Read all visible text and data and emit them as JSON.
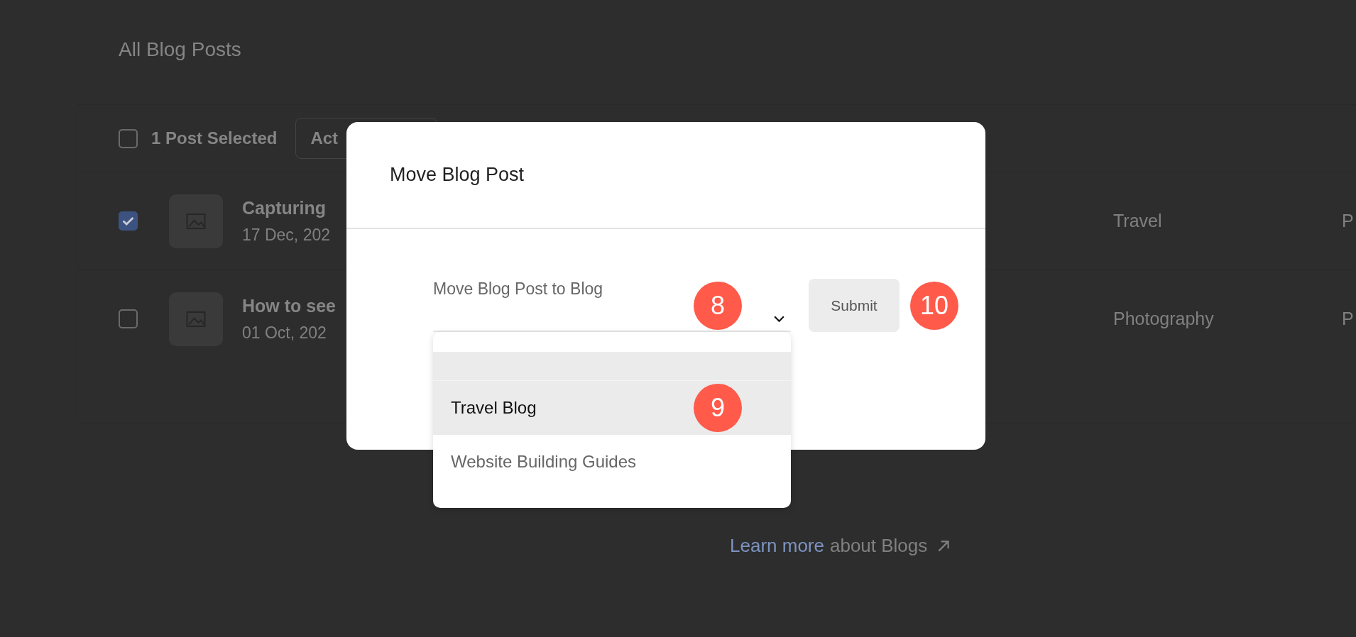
{
  "page": {
    "title": "All Blog Posts",
    "toolbar": {
      "select_all_checked": false,
      "selection_count": "1 Post Selected",
      "actions_button": "Act"
    },
    "posts": [
      {
        "checked": true,
        "title": "Capturing",
        "date": "17 Dec, 202",
        "category": "Travel",
        "status": "P"
      },
      {
        "checked": false,
        "title": "How to see",
        "date": "01 Oct, 202",
        "category": "Photography",
        "status": "P"
      }
    ],
    "help_link": {
      "link": "Learn more",
      "text": "about Blogs"
    }
  },
  "modal": {
    "title": "Move Blog Post",
    "field_label": "Move Blog Post to Blog",
    "dropdown": {
      "blank_option_selected": true,
      "options": [
        {
          "label": "Travel Blog",
          "selected": true
        },
        {
          "label": "Website Building Guides",
          "selected": false
        }
      ]
    },
    "submit": "Submit"
  },
  "annotations": [
    {
      "label": "8"
    },
    {
      "label": "9"
    },
    {
      "label": "10"
    }
  ]
}
